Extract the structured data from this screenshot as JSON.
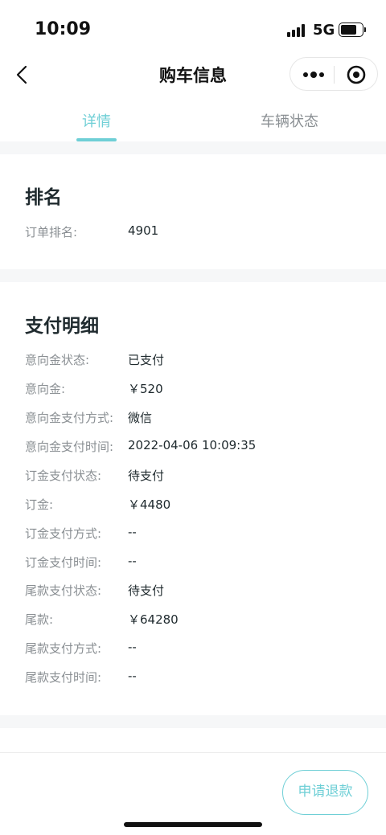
{
  "status_bar": {
    "time": "10:09",
    "network": "5G"
  },
  "nav": {
    "title": "购车信息"
  },
  "tabs": [
    {
      "label": "详情",
      "active": true
    },
    {
      "label": "车辆状态",
      "active": false
    }
  ],
  "ranking": {
    "title": "排名",
    "rows": [
      {
        "label": "订单排名:",
        "value": "4901"
      }
    ]
  },
  "payment": {
    "title": "支付明细",
    "rows": [
      {
        "label": "意向金状态:",
        "value": "已支付"
      },
      {
        "label": "意向金:",
        "value": "￥520"
      },
      {
        "label": "意向金支付方式:",
        "value": "微信"
      },
      {
        "label": "意向金支付时间:",
        "value": "2022-04-06 10:09:35"
      },
      {
        "label": "订金支付状态:",
        "value": "待支付"
      },
      {
        "label": "订金:",
        "value": "￥4480"
      },
      {
        "label": "订金支付方式:",
        "value": "--"
      },
      {
        "label": "订金支付时间:",
        "value": "--"
      },
      {
        "label": "尾款支付状态:",
        "value": "待支付"
      },
      {
        "label": "尾款:",
        "value": "￥64280"
      },
      {
        "label": "尾款支付方式:",
        "value": "--"
      },
      {
        "label": "尾款支付时间:",
        "value": "--"
      }
    ]
  },
  "footer": {
    "refund_label": "申请退款"
  },
  "colors": {
    "accent": "#6fcfd6",
    "label_gray": "#8a8f93",
    "text_dark": "#1f2a2e",
    "section_gap": "#f6f7f8"
  }
}
